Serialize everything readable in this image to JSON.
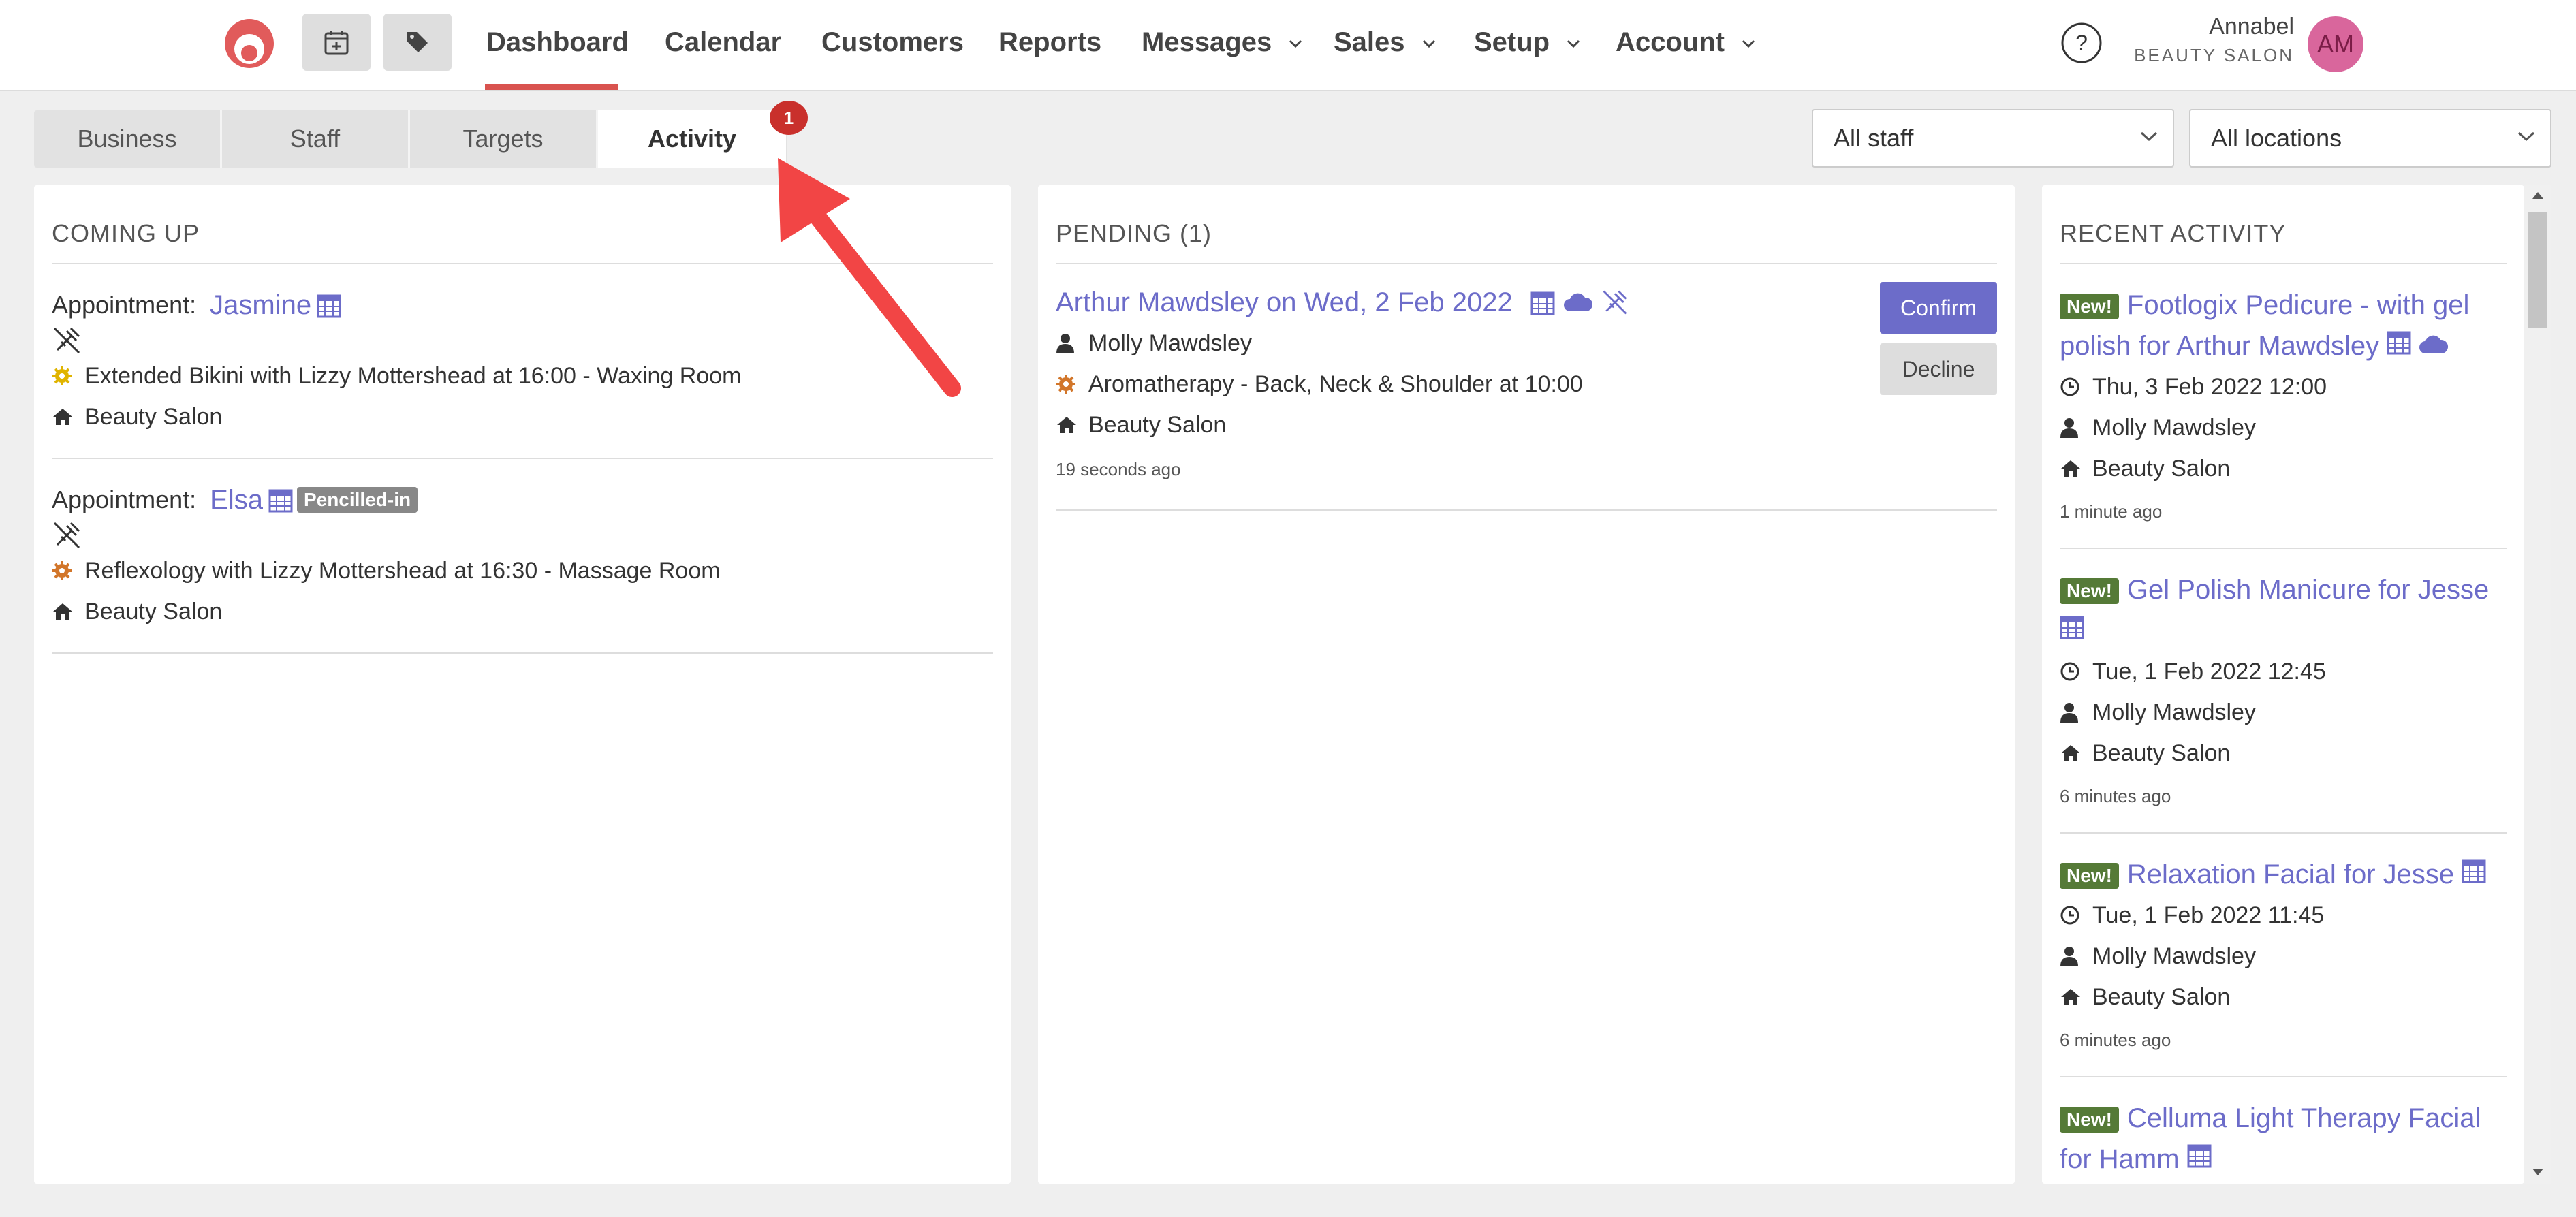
{
  "nav": {
    "links": [
      "Dashboard",
      "Calendar",
      "Customers",
      "Reports",
      "Messages",
      "Sales",
      "Setup",
      "Account"
    ],
    "active": "Dashboard",
    "user_name": "Annabel",
    "user_org": "BEAUTY SALON",
    "avatar_initials": "AM",
    "accent_color": "#d9534f"
  },
  "tabs": {
    "items": [
      "Business",
      "Staff",
      "Targets",
      "Activity"
    ],
    "active": "Activity",
    "badge": "1"
  },
  "filters": {
    "staff": "All staff",
    "locations": "All locations"
  },
  "coming_up": {
    "title": "COMING UP",
    "items": [
      {
        "label": "Appointment:",
        "name": "Jasmine",
        "pill": "",
        "service": "Extended Bikini with Lizzy Mottershead at 16:00 - Waxing Room",
        "location": "Beauty Salon"
      },
      {
        "label": "Appointment:",
        "name": "Elsa",
        "pill": "Pencilled-in",
        "service": "Reflexology with Lizzy Mottershead at 16:30 - Massage Room",
        "location": "Beauty Salon"
      }
    ]
  },
  "pending": {
    "title": "PENDING (1)",
    "item": {
      "title": "Arthur Mawdsley on Wed, 2 Feb 2022",
      "staff": "Molly Mawdsley",
      "service": "Aromatherapy - Back, Neck & Shoulder at 10:00",
      "location": "Beauty Salon",
      "ago": "19 seconds ago",
      "confirm_label": "Confirm",
      "decline_label": "Decline"
    }
  },
  "recent": {
    "title": "RECENT ACTIVITY",
    "new_label": "New!",
    "items": [
      {
        "line1": "Footlogix Pedicure - with gel",
        "line2": "polish for Arthur Mawdsley",
        "datetime": "Thu, 3 Feb 2022 12:00",
        "staff": "Molly Mawdsley",
        "location": "Beauty Salon",
        "ago": "1 minute ago"
      },
      {
        "line1": "Gel Polish Manicure for Jesse",
        "line2": "",
        "datetime": "Tue, 1 Feb 2022 12:45",
        "staff": "Molly Mawdsley",
        "location": "Beauty Salon",
        "ago": "6 minutes ago"
      },
      {
        "line1": "Relaxation Facial for Jesse",
        "line2": "",
        "datetime": "Tue, 1 Feb 2022 11:45",
        "staff": "Molly Mawdsley",
        "location": "Beauty Salon",
        "ago": "6 minutes ago"
      },
      {
        "line1": "Celluma Light Therapy Facial",
        "line2": "for Hamm"
      }
    ]
  }
}
